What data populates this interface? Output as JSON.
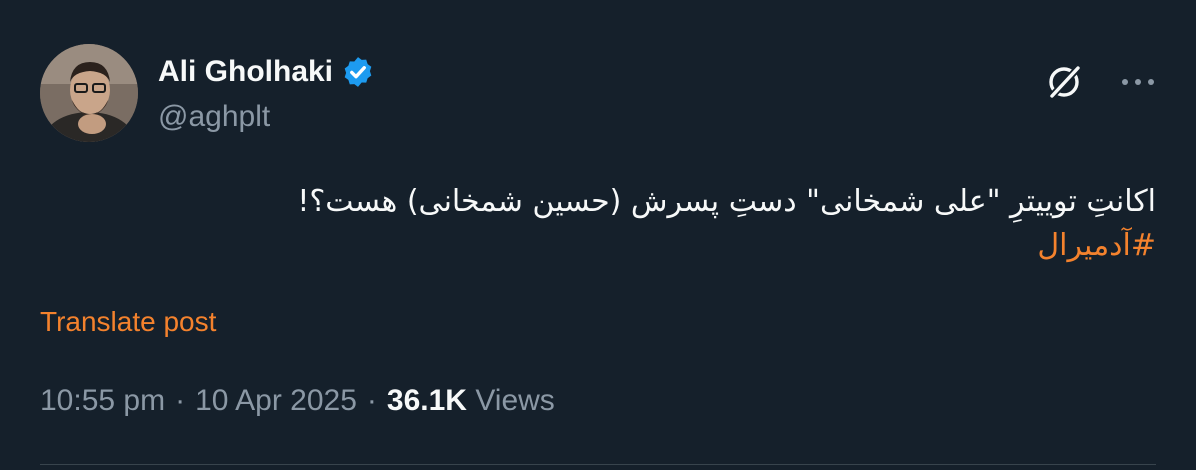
{
  "author": {
    "display_name": "Ali Gholhaki",
    "handle": "@aghplt",
    "verified": true
  },
  "tweet": {
    "line1": "اکانتِ توییترِ \"علی شمخانی\" دستِ پسرش (حسین شمخانی) هست؟!",
    "hashtag": "#آدمیرال"
  },
  "actions": {
    "grok_icon": "grok-icon",
    "more_icon": "more-icon"
  },
  "translate_label": "Translate post",
  "meta": {
    "time": "10:55 pm",
    "sep1": "·",
    "date": "10 Apr 2025",
    "sep2": "·",
    "views_count": "36.1K",
    "views_label": "Views"
  },
  "colors": {
    "background": "#15202b",
    "text": "#f7f9f9",
    "secondary": "#8b98a5",
    "accent": "#f4822d",
    "verified": "#1d9bf0"
  }
}
